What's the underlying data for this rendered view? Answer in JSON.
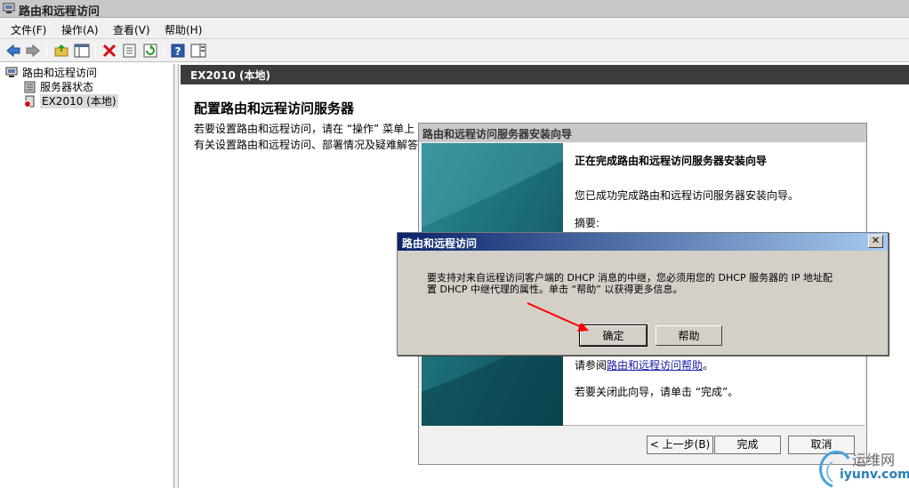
{
  "window": {
    "title": "路由和远程访问"
  },
  "menu": [
    "文件(F)",
    "操作(A)",
    "查看(V)",
    "帮助(H)"
  ],
  "toolbar": {
    "buttons": [
      "back-icon",
      "forward-icon",
      "up-folder-icon",
      "show-hide-tree-icon",
      "delete-icon",
      "properties-icon",
      "refresh-icon",
      "help-icon",
      "action-pane-icon"
    ]
  },
  "tree": {
    "root": "路由和远程访问",
    "items": [
      {
        "label": "服务器状态",
        "icon": "server-status-icon"
      },
      {
        "label": "EX2010 (本地)",
        "icon": "server-icon"
      }
    ]
  },
  "pane": {
    "header": "EX2010 (本地)",
    "heading": "配置路由和远程访问服务器",
    "line1": "若要设置路由和远程访问，请在 “操作” 菜单上",
    "line2": "有关设置路由和远程访问、部署情况及疑难解答"
  },
  "wizard": {
    "title": "路由和远程访问服务器安装向导",
    "heading": "正在完成路由和远程访问服务器安装向导",
    "success": "您已成功完成路由和远程访问服务器安装向导。",
    "summary_label": "摘要:",
    "help_prefix": "请参阅",
    "help_link": "路由和远程访问帮助",
    "help_suffix": "。",
    "close_hint": "若要关闭此向导，请单击 “完成”。",
    "back_button": "< 上一步(B)",
    "finish_button": "完成",
    "cancel_button": "取消"
  },
  "dialog": {
    "title": "路由和远程访问",
    "close_glyph": "✕",
    "message_line1": "要支持对来自远程访问客户端的 DHCP 消息的中继，您必须用您的 DHCP 服务器的 IP 地址配",
    "message_line2": "置 DHCP 中继代理的属性。单击 “帮助” 以获得更多信息。",
    "ok_button": "确定",
    "help_button": "帮助"
  },
  "watermark": {
    "cn": "运维网",
    "url": "iyunv.com"
  },
  "colors": {
    "dialog_title_start": "#0a246a",
    "dialog_title_end": "#a6caf0",
    "pane_header": "#3c3c3c",
    "annotation_arrow": "#ff0000"
  }
}
